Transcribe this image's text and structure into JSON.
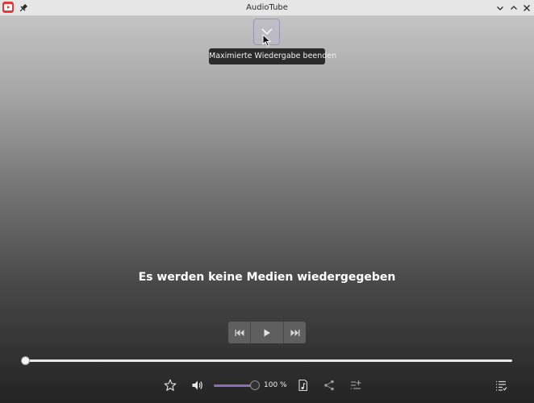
{
  "window": {
    "title": "AudioTube"
  },
  "player": {
    "collapse_tooltip": "Maximierte Wiedergabe beenden",
    "empty_message": "Es werden keine Medien wiedergegeben",
    "progress": 0.0,
    "volume_label": "100 %",
    "volume": 1.0
  },
  "icons": {
    "app": "audiotube-icon",
    "pin": "pin-icon",
    "collapse": "chevron-down-icon",
    "previous": "skip-previous-icon",
    "play": "play-icon",
    "next": "skip-next-icon",
    "favorite": "star-icon",
    "volume": "volume-icon",
    "lyrics": "lyrics-icon",
    "share": "share-icon",
    "add_to_queue": "add-to-queue-icon",
    "queue": "queue-icon"
  },
  "colors": {
    "accent": "#8a6fb6",
    "app_icon": "#e03a3a",
    "tooltip_bg": "#2b2b2b"
  }
}
